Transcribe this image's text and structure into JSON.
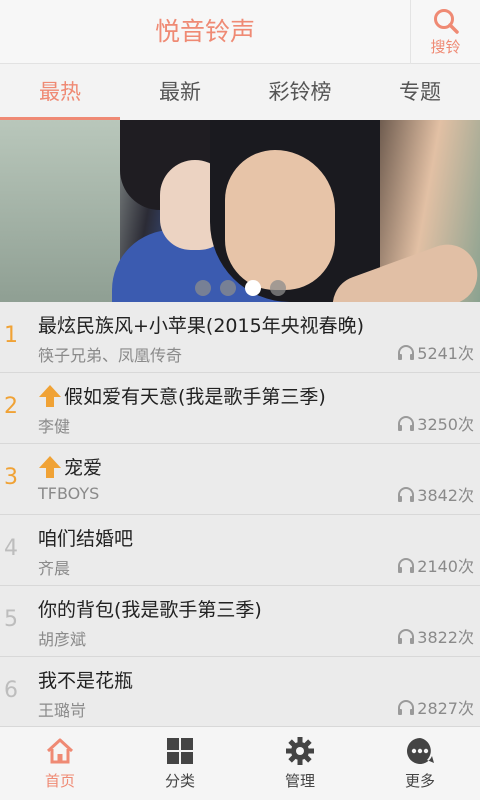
{
  "header": {
    "title": "悦音铃声",
    "search_label": "搜铃"
  },
  "tabs": [
    {
      "label": "最热",
      "active": true
    },
    {
      "label": "最新",
      "active": false
    },
    {
      "label": "彩铃榜",
      "active": false
    },
    {
      "label": "专题",
      "active": false
    }
  ],
  "banner": {
    "dots": 4,
    "active_dot": 3
  },
  "songs": [
    {
      "rank": "1",
      "title": "最炫民族风+小苹果(2015年央视春晚)",
      "artist": "筷子兄弟、凤凰传奇",
      "plays": "5241次",
      "up": false
    },
    {
      "rank": "2",
      "title": "假如爱有天意(我是歌手第三季)",
      "artist": "李健",
      "plays": "3250次",
      "up": true
    },
    {
      "rank": "3",
      "title": "宠爱",
      "artist": "TFBOYS",
      "plays": "3842次",
      "up": true
    },
    {
      "rank": "4",
      "title": "咱们结婚吧",
      "artist": "齐晨",
      "plays": "2140次",
      "up": false
    },
    {
      "rank": "5",
      "title": "你的背包(我是歌手第三季)",
      "artist": "胡彦斌",
      "plays": "3822次",
      "up": false
    },
    {
      "rank": "6",
      "title": "我不是花瓶",
      "artist": "王璐岢",
      "plays": "2827次",
      "up": false
    }
  ],
  "bottom_nav": [
    {
      "label": "首页",
      "icon": "home-icon",
      "active": true
    },
    {
      "label": "分类",
      "icon": "grid-icon",
      "active": false
    },
    {
      "label": "管理",
      "icon": "gear-icon",
      "active": false
    },
    {
      "label": "更多",
      "icon": "more-icon",
      "active": false
    }
  ],
  "colors": {
    "accent": "#ef8a74",
    "rank_top": "#f0a235",
    "up_arrow": "#f0a235"
  }
}
